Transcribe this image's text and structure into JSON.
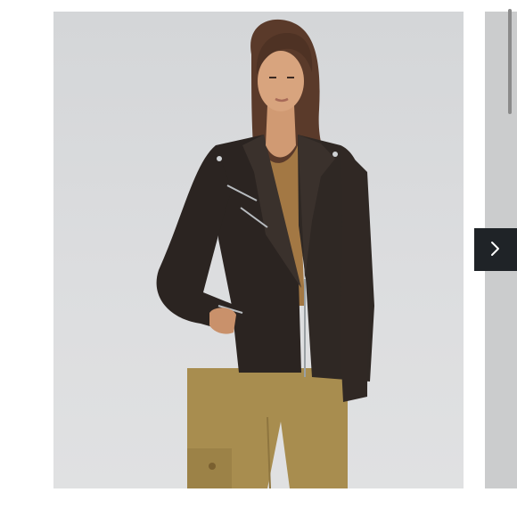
{
  "product_gallery": {
    "main_image": {
      "subject": "model-wearing-black-leather-moto-jacket",
      "icon": "product-photo"
    },
    "next_image": {
      "icon": "product-photo-partial"
    },
    "next_button": {
      "icon": "chevron-right-icon",
      "icon_color": "#ffffff",
      "background_color": "#1f2327"
    },
    "scrollbar_color": "#8a8a8a"
  },
  "colors": {
    "backdrop": "#d6d8da",
    "jacket": "#2b2421",
    "shirt": "#a37844",
    "trousers": "#a88d4f"
  }
}
